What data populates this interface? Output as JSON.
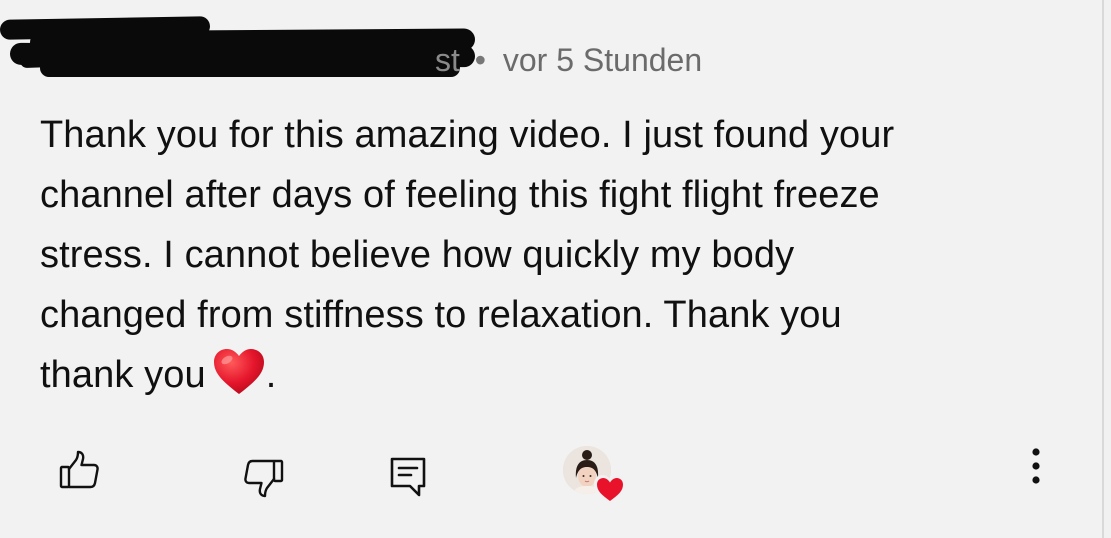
{
  "comment": {
    "author_redacted": true,
    "author_tail": "st",
    "separator": "•",
    "timestamp": "vor 5 Stunden",
    "lines": [
      "Thank you for this amazing video. I just found your",
      "channel after days of feeling this fight flight freeze",
      "stress. I cannot believe how quickly my body",
      "changed from stiffness to relaxation. Thank you",
      "thank you"
    ],
    "end_punct": ".",
    "emoji": "red-heart"
  },
  "actions": {
    "like_icon": "thumbs-up-icon",
    "dislike_icon": "thumbs-down-icon",
    "reply_icon": "reply-comment-icon",
    "creator_heart_icon": "creator-heart-icon",
    "more_icon": "more-vertical-icon"
  },
  "colors": {
    "background": "#f2f2f2",
    "text": "#101010",
    "meta_text": "#6b6b6b",
    "heart": "#e0142c",
    "redaction": "#0a0a0a"
  }
}
